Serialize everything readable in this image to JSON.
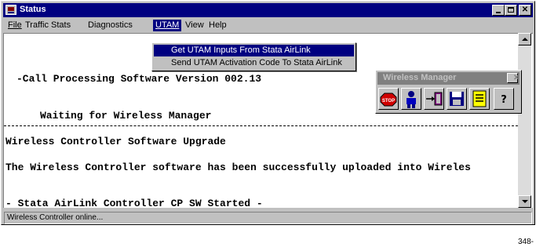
{
  "window": {
    "title": "Status",
    "app_icon": "status-app-icon"
  },
  "menubar": {
    "file": "File",
    "traffic_stats": "Traffic Stats",
    "diagnostics": "Diagnostics",
    "utam": "UTAM",
    "view": "View",
    "help": "Help"
  },
  "utam_menu": {
    "item1": "Get UTAM Inputs From Stata AirLink",
    "item2": "Send UTAM Activation Code To Stata AirLink"
  },
  "content": {
    "line1": "-Call Processing Software Version 002.13",
    "line2": "Waiting for Wireless Manager",
    "line3": "Wireless Controller Software Upgrade",
    "line4": "The Wireless Controller software has been successfully uploaded into Wireles",
    "line5": "- Stata AirLink Controller CP SW Started -"
  },
  "wireless_manager": {
    "title": "Wireless Manager",
    "tools": [
      "stop-icon",
      "person-icon",
      "transfer-icon",
      "save-icon",
      "list-icon",
      "help-icon"
    ]
  },
  "statusbar": {
    "text": "Wireless Controller online..."
  },
  "figure_number": "348-",
  "colors": {
    "title_bar": "#000080",
    "menu_highlight": "#000080",
    "face": "#c0c0c0",
    "inactive_title": "#808080"
  }
}
